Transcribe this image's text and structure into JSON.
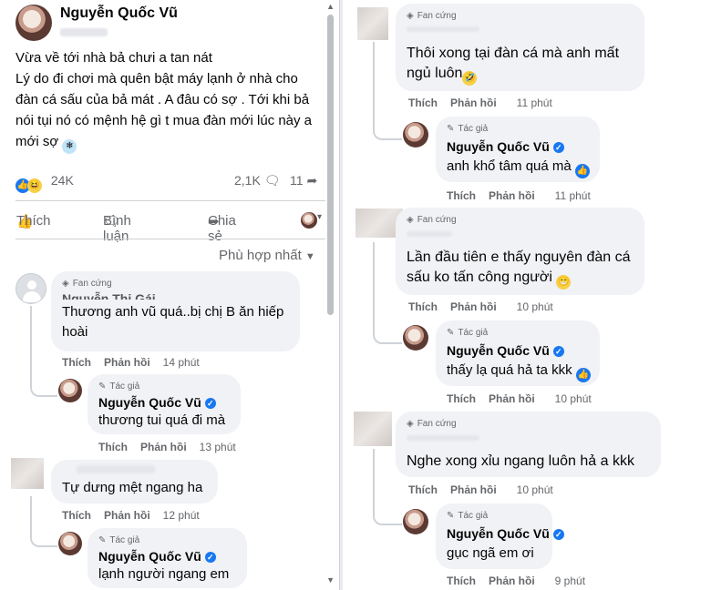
{
  "post": {
    "author": "Nguyễn Quốc Vũ",
    "body": [
      "Vừa về tới nhà bả chưi a tan nát",
      "Lý do đi chơi mà quên bật máy lạnh ở nhà cho",
      "đàn cá sấu của bả mát . A đâu có sợ . Tới khi bả",
      "nói tụi nó có mệnh hệ gì t mua đàn mới lúc này a",
      "mới sợ"
    ],
    "reaction_count": "24K",
    "comment_count": "2,1K",
    "share_count": "11",
    "like_label": "Thích",
    "comment_label": "Bình luận",
    "share_label": "Chia sẻ",
    "sort_label": "Phù hợp nhất"
  },
  "labels": {
    "fan_badge": "Fan cứng",
    "author_badge": "Tác giả",
    "like": "Thích",
    "reply": "Phản hồi"
  },
  "left_comments": [
    {
      "name": "Nguyễn Thị Gái",
      "text": [
        "Thương anh vũ quá..bị chị B ăn hiếp",
        "hoài"
      ],
      "time": "14 phút"
    },
    {
      "name": "Nguyễn Quốc Vũ",
      "text": [
        "thương tui quá đi mà"
      ],
      "time": "13 phút"
    },
    {
      "text": [
        "Tự dưng mệt ngang ha"
      ],
      "time": "12 phút"
    },
    {
      "name": "Nguyễn Quốc Vũ",
      "text": [
        "lạnh người ngang em"
      ]
    }
  ],
  "right_comments": [
    {
      "text": [
        "Thôi xong tại đàn cá mà anh mất",
        "ngủ luôn"
      ],
      "time": "11 phút"
    },
    {
      "name": "Nguyễn Quốc Vũ",
      "text": [
        "anh khổ tâm quá mà"
      ],
      "time": "11 phút"
    },
    {
      "text": [
        "Lần đầu tiên e thấy nguyên đàn cá",
        "sấu ko tấn công người"
      ],
      "time": "10 phút"
    },
    {
      "name": "Nguyễn Quốc Vũ",
      "text": [
        "thấy lạ quá hả ta kkk"
      ],
      "time": "10 phút"
    },
    {
      "text": [
        "Nghe xong xỉu ngang luôn hả a kkk"
      ],
      "time": "10 phút"
    },
    {
      "name": "Nguyễn Quốc Vũ",
      "text": [
        "gục ngã em ơi"
      ],
      "time": "9 phút"
    }
  ]
}
